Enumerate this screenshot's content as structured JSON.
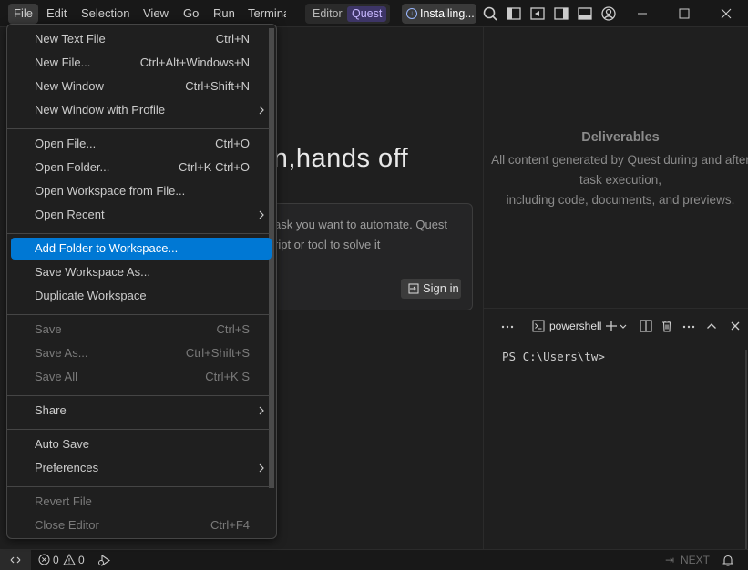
{
  "menubar": {
    "items": [
      "File",
      "Edit",
      "Selection",
      "View",
      "Go",
      "Run",
      "Termina"
    ],
    "active": "File"
  },
  "mode_switch": {
    "editor": "Editor",
    "quest": "Quest"
  },
  "status_chip": {
    "label": "Installing..."
  },
  "icons": {
    "titlebar": [
      "search-icon",
      "toggle-primary-sidebar-icon",
      "toggle-panel-left-icon",
      "toggle-secondary-sidebar-icon",
      "toggle-panel-icon",
      "account-icon"
    ],
    "window": [
      "minimize-icon",
      "maximize-icon",
      "close-icon"
    ]
  },
  "editor": {
    "hero": "t on,hands off",
    "prompt_text": "ask you want to automate. Quest ript or tool to solve it",
    "signin": "Sign in"
  },
  "deliverables": {
    "title": "Deliverables",
    "line1": "All content generated by Quest during and after",
    "line2": "task execution,",
    "line3": "including code, documents, and previews."
  },
  "terminal": {
    "tab_label": "powershell",
    "prompt": "PS C:\\Users\\tw>"
  },
  "statusbar": {
    "errors": "0",
    "warnings": "0",
    "next": "NEXT"
  },
  "file_menu": {
    "items": [
      {
        "label": "New Text File",
        "shortcut": "Ctrl+N",
        "submenu": false,
        "disabled": false,
        "selected": false
      },
      {
        "label": "New File...",
        "shortcut": "Ctrl+Alt+Windows+N",
        "submenu": false,
        "disabled": false,
        "selected": false
      },
      {
        "label": "New Window",
        "shortcut": "Ctrl+Shift+N",
        "submenu": false,
        "disabled": false,
        "selected": false
      },
      {
        "label": "New Window with Profile",
        "shortcut": "",
        "submenu": true,
        "disabled": false,
        "selected": false
      },
      {
        "label": "Open File...",
        "shortcut": "Ctrl+O",
        "submenu": false,
        "disabled": false,
        "selected": false
      },
      {
        "label": "Open Folder...",
        "shortcut": "Ctrl+K Ctrl+O",
        "submenu": false,
        "disabled": false,
        "selected": false
      },
      {
        "label": "Open Workspace from File...",
        "shortcut": "",
        "submenu": false,
        "disabled": false,
        "selected": false
      },
      {
        "label": "Open Recent",
        "shortcut": "",
        "submenu": true,
        "disabled": false,
        "selected": false
      },
      {
        "label": "Add Folder to Workspace...",
        "shortcut": "",
        "submenu": false,
        "disabled": false,
        "selected": true
      },
      {
        "label": "Save Workspace As...",
        "shortcut": "",
        "submenu": false,
        "disabled": false,
        "selected": false
      },
      {
        "label": "Duplicate Workspace",
        "shortcut": "",
        "submenu": false,
        "disabled": false,
        "selected": false
      },
      {
        "label": "Save",
        "shortcut": "Ctrl+S",
        "submenu": false,
        "disabled": true,
        "selected": false
      },
      {
        "label": "Save As...",
        "shortcut": "Ctrl+Shift+S",
        "submenu": false,
        "disabled": true,
        "selected": false
      },
      {
        "label": "Save All",
        "shortcut": "Ctrl+K S",
        "submenu": false,
        "disabled": true,
        "selected": false
      },
      {
        "label": "Share",
        "shortcut": "",
        "submenu": true,
        "disabled": false,
        "selected": false
      },
      {
        "label": "Auto Save",
        "shortcut": "",
        "submenu": false,
        "disabled": false,
        "selected": false
      },
      {
        "label": "Preferences",
        "shortcut": "",
        "submenu": true,
        "disabled": false,
        "selected": false
      },
      {
        "label": "Revert File",
        "shortcut": "",
        "submenu": false,
        "disabled": true,
        "selected": false
      },
      {
        "label": "Close Editor",
        "shortcut": "Ctrl+F4",
        "submenu": false,
        "disabled": true,
        "selected": false
      }
    ]
  },
  "colors": {
    "accent": "#0078d4",
    "quest_badge": "#3d3566",
    "background": "#1f1f1f"
  }
}
